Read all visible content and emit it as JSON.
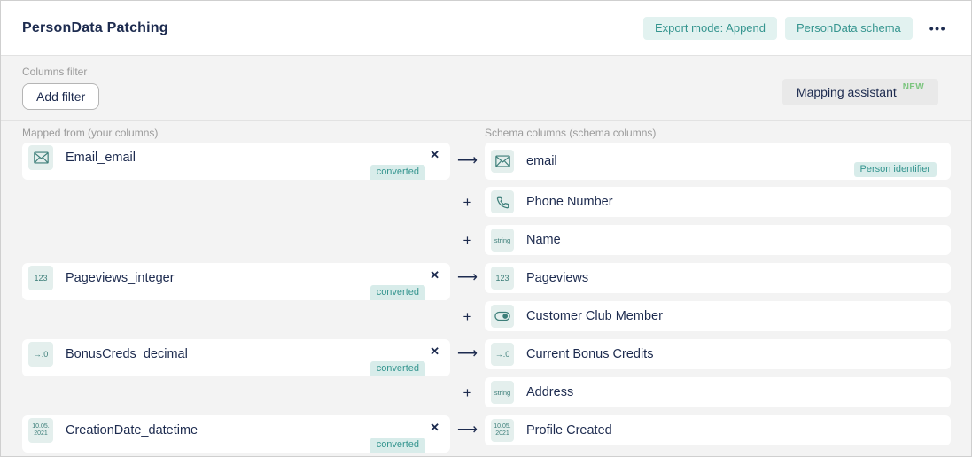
{
  "header": {
    "title": "PersonData Patching",
    "export_mode_label": "Export mode: Append",
    "schema_label": "PersonData schema",
    "more_label": "•••"
  },
  "filter": {
    "label": "Columns filter",
    "add_filter_label": "Add filter",
    "mapping_assistant_label": "Mapping assistant",
    "new_badge": "NEW"
  },
  "mapping": {
    "left_header": "Mapped from (your columns)",
    "right_header": "Schema columns (schema columns)",
    "rows": [
      {
        "connector": "arrow",
        "left": {
          "icon": "email-icon",
          "label": "Email_email",
          "badge": "converted"
        },
        "right": {
          "icon": "email-icon",
          "label": "email",
          "badge": "Person identifier"
        }
      },
      {
        "connector": "plus",
        "left": null,
        "right": {
          "icon": "phone-icon",
          "label": "Phone Number"
        }
      },
      {
        "connector": "plus",
        "left": null,
        "right": {
          "icon": "string-icon",
          "icon_text": "string",
          "label": "Name"
        }
      },
      {
        "connector": "arrow",
        "left": {
          "icon": "integer-icon",
          "icon_text": "123",
          "label": "Pageviews_integer",
          "badge": "converted"
        },
        "right": {
          "icon": "integer-icon",
          "icon_text": "123",
          "label": "Pageviews"
        }
      },
      {
        "connector": "plus",
        "left": null,
        "right": {
          "icon": "boolean-icon",
          "label": "Customer Club Member"
        }
      },
      {
        "connector": "arrow",
        "left": {
          "icon": "decimal-icon",
          "icon_text": "→.0",
          "label": "BonusCreds_decimal",
          "badge": "converted"
        },
        "right": {
          "icon": "decimal-icon",
          "icon_text": "→.0",
          "label": "Current Bonus Credits"
        }
      },
      {
        "connector": "plus",
        "left": null,
        "right": {
          "icon": "string-icon",
          "icon_text": "string",
          "label": "Address"
        }
      },
      {
        "connector": "arrow",
        "left": {
          "icon": "datetime-icon",
          "icon_lines": [
            "10.05.",
            "2021"
          ],
          "label": "CreationDate_datetime",
          "badge": "converted"
        },
        "right": {
          "icon": "datetime-icon",
          "icon_lines": [
            "10.05.",
            "2021"
          ],
          "label": "Profile Created"
        }
      }
    ]
  },
  "colors": {
    "navy": "#1d2b4f",
    "teal": "#35958f",
    "teal-bg": "#e2f2f0",
    "teal-bg2": "#d8ecea",
    "icon-bg": "#e4efed",
    "icon-teal": "#3c7e79",
    "new-green": "#7cc57f",
    "section-bg": "#f3f3f3",
    "assistant-bg": "#e9e9e9",
    "divider": "#e2e2e2",
    "gray-label": "#9b9b9b",
    "border-outer": "#cfcfcf"
  }
}
